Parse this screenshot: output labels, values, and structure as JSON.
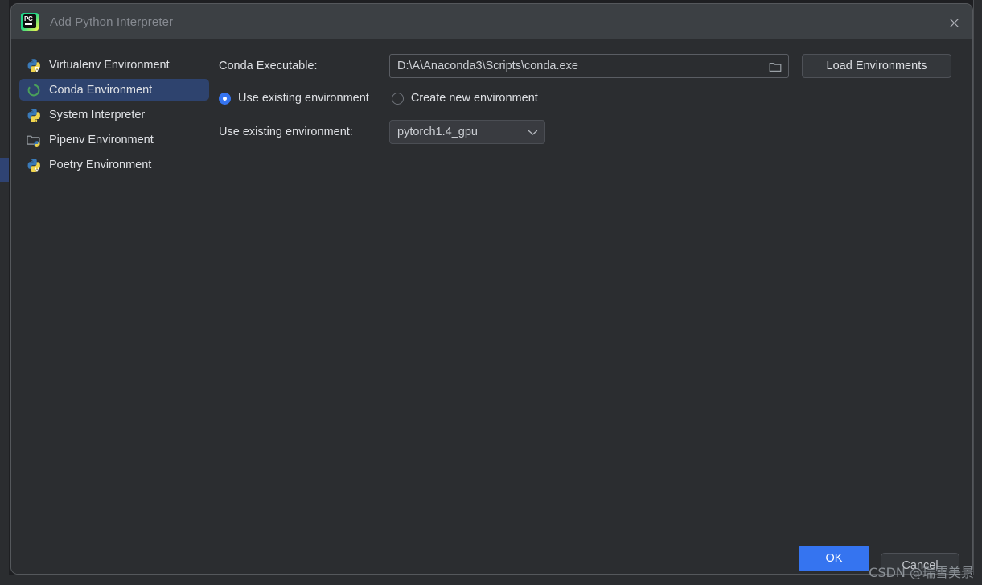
{
  "window": {
    "title": "Add Python Interpreter",
    "app_icon": "pycharm-icon",
    "close_icon": "close-icon"
  },
  "sidebar": {
    "items": [
      {
        "label": "Virtualenv Environment",
        "icon": "python-virtualenv-icon",
        "selected": false
      },
      {
        "label": "Conda Environment",
        "icon": "conda-icon",
        "selected": true
      },
      {
        "label": "System Interpreter",
        "icon": "python-icon",
        "selected": false
      },
      {
        "label": "Pipenv Environment",
        "icon": "pipenv-folder-icon",
        "selected": false
      },
      {
        "label": "Poetry Environment",
        "icon": "python-poetry-icon",
        "selected": false
      }
    ]
  },
  "form": {
    "conda_executable_label": "Conda Executable:",
    "conda_executable_value": "D:\\A\\Anaconda3\\Scripts\\conda.exe",
    "conda_executable_placeholder": "",
    "browse_icon": "folder-icon",
    "load_environments_label": "Load Environments",
    "radio_use_existing_label": "Use existing environment",
    "radio_create_new_label": "Create new environment",
    "radio_selected": "use_existing",
    "use_existing_env_label": "Use existing environment:",
    "use_existing_env_value": "pytorch1.4_gpu",
    "combo_arrow_icon": "chevron-down-icon"
  },
  "footer": {
    "ok_label": "OK",
    "cancel_label": "Cancel"
  },
  "watermark": {
    "text": "CSDN @瑞雪美景"
  },
  "colors": {
    "accent": "#3574f0",
    "titlebar": "#3c4044",
    "dialog_bg": "#2b2d30",
    "selection": "#2e436e",
    "text": "#dfe1e5",
    "muted_text": "#868a91",
    "conda_green": "#43b02a"
  }
}
